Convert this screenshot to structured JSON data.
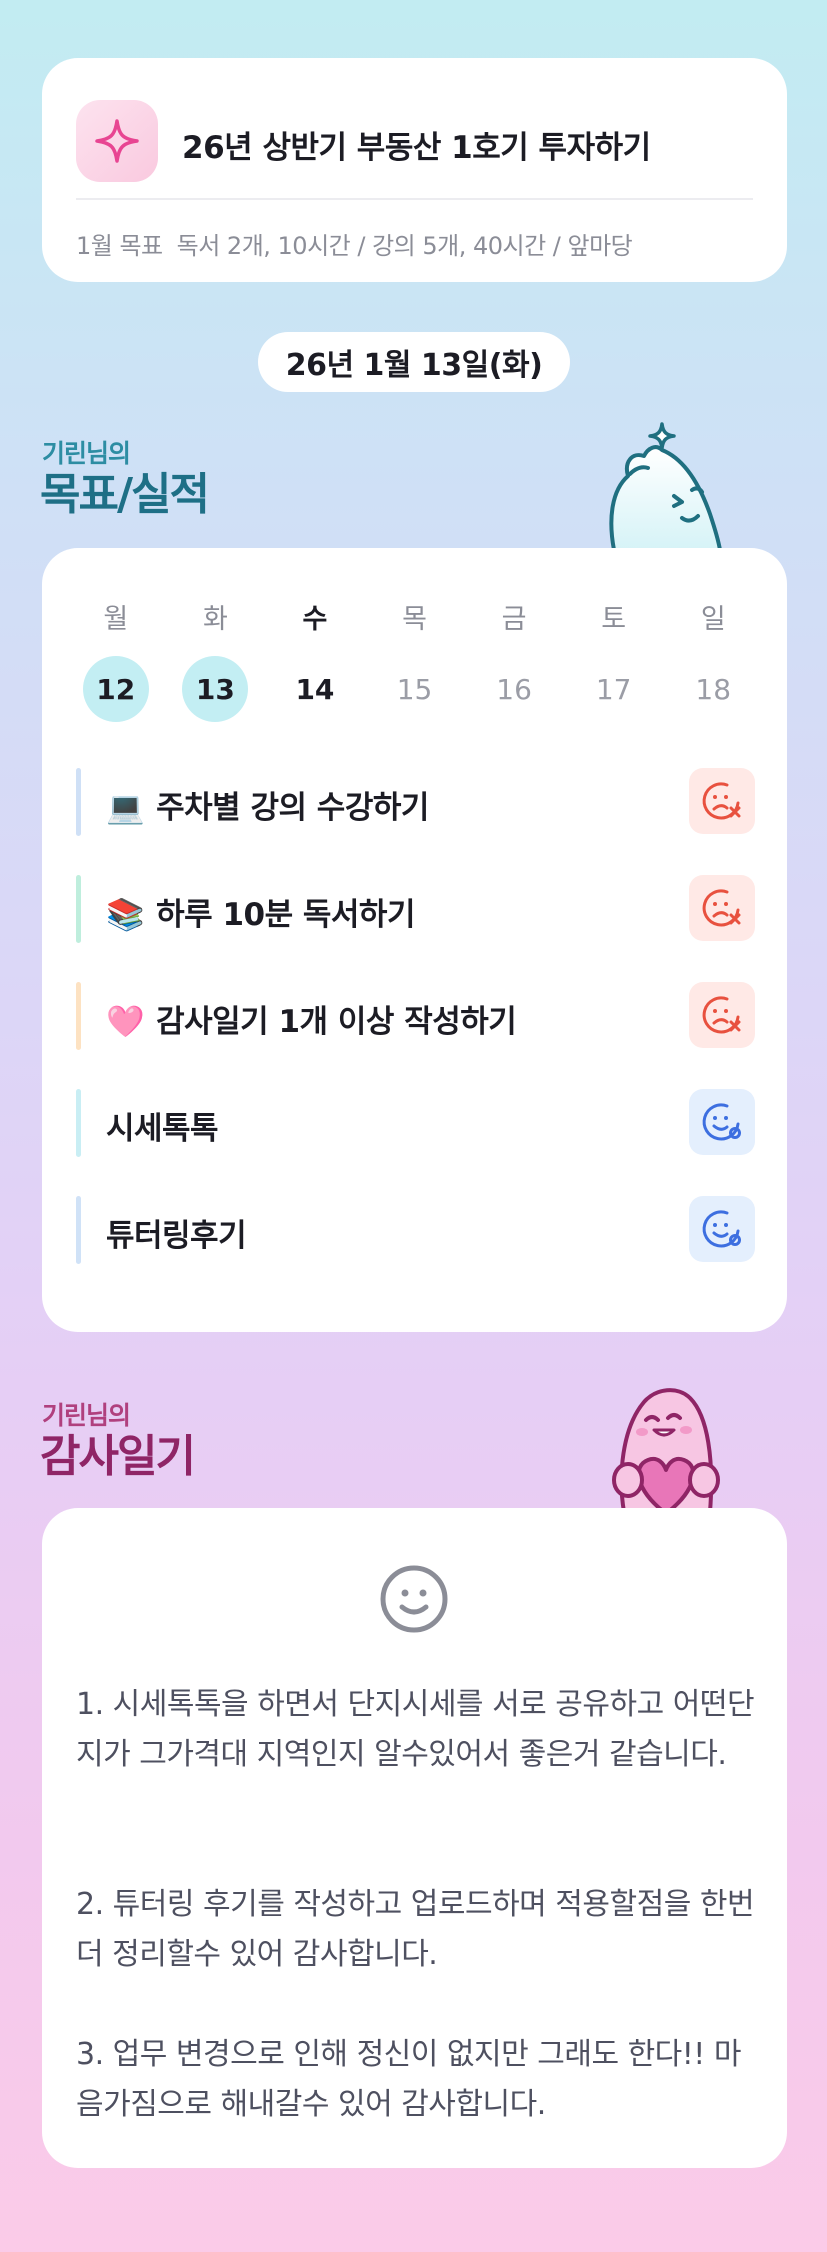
{
  "goal_card": {
    "title": "26년 상반기 부동산 1호기 투자하기",
    "subtitle_label": "1월 목표",
    "subtitle_text": "독서 2개, 10시간 / 강의 5개, 40시간 / 앞마당",
    "icon": "sparkle-icon"
  },
  "date_label": "26년 1월 13일(화)",
  "goals_section": {
    "owner": "기린님의",
    "title": "목표/실적"
  },
  "week": {
    "days": [
      {
        "name": "월",
        "num": "12",
        "state": "done"
      },
      {
        "name": "화",
        "num": "13",
        "state": "done"
      },
      {
        "name": "수",
        "num": "14",
        "state": "today"
      },
      {
        "name": "목",
        "num": "15",
        "state": "future"
      },
      {
        "name": "금",
        "num": "16",
        "state": "future"
      },
      {
        "name": "토",
        "num": "17",
        "state": "future"
      },
      {
        "name": "일",
        "num": "18",
        "state": "future"
      }
    ]
  },
  "goals": [
    {
      "emoji": "💻",
      "label": "주차별 강의 수강하기",
      "bar_color": "#cfe0f6",
      "status": "fail",
      "status_icon": "sad-face-x-icon"
    },
    {
      "emoji": "📚",
      "label": "하루 10분 독서하기",
      "bar_color": "#bfeedd",
      "status": "fail",
      "status_icon": "sad-face-x-icon"
    },
    {
      "emoji": "🩷",
      "label": "감사일기 1개 이상 작성하기",
      "bar_color": "#fde2c2",
      "status": "fail",
      "status_icon": "sad-face-x-icon"
    },
    {
      "emoji": "",
      "label": "시세톡톡",
      "bar_color": "#c9eef4",
      "status": "ok",
      "status_icon": "smile-face-check-icon"
    },
    {
      "emoji": "",
      "label": "튜터링후기",
      "bar_color": "#d0e2f7",
      "status": "ok",
      "status_icon": "smile-face-check-icon"
    }
  ],
  "diary_section": {
    "owner": "기린님의",
    "title": "감사일기"
  },
  "diary": {
    "icon": "smile-icon",
    "p1": "1. 시세톡톡을 하면서 단지시세를 서로 공유하고 어떤단지가 그가격대 지역인지 알수있어서 좋은거 같습니다.",
    "p2": "2. 튜터링 후기를 작성하고 업로드하며 적용할점을 한번더 정리할수 있어 감사합니다.",
    "p3": "3. 업무 변경으로 인해 정신이 없지만 그래도 한다!! 마음가짐으로 해내갈수 있어 감사합니다."
  },
  "colors": {
    "fail": "#e8513f",
    "ok": "#3d6fe0",
    "done_day": "#c3eef3",
    "goal_header": "#1e6f86",
    "diary_header": "#8f2566"
  }
}
